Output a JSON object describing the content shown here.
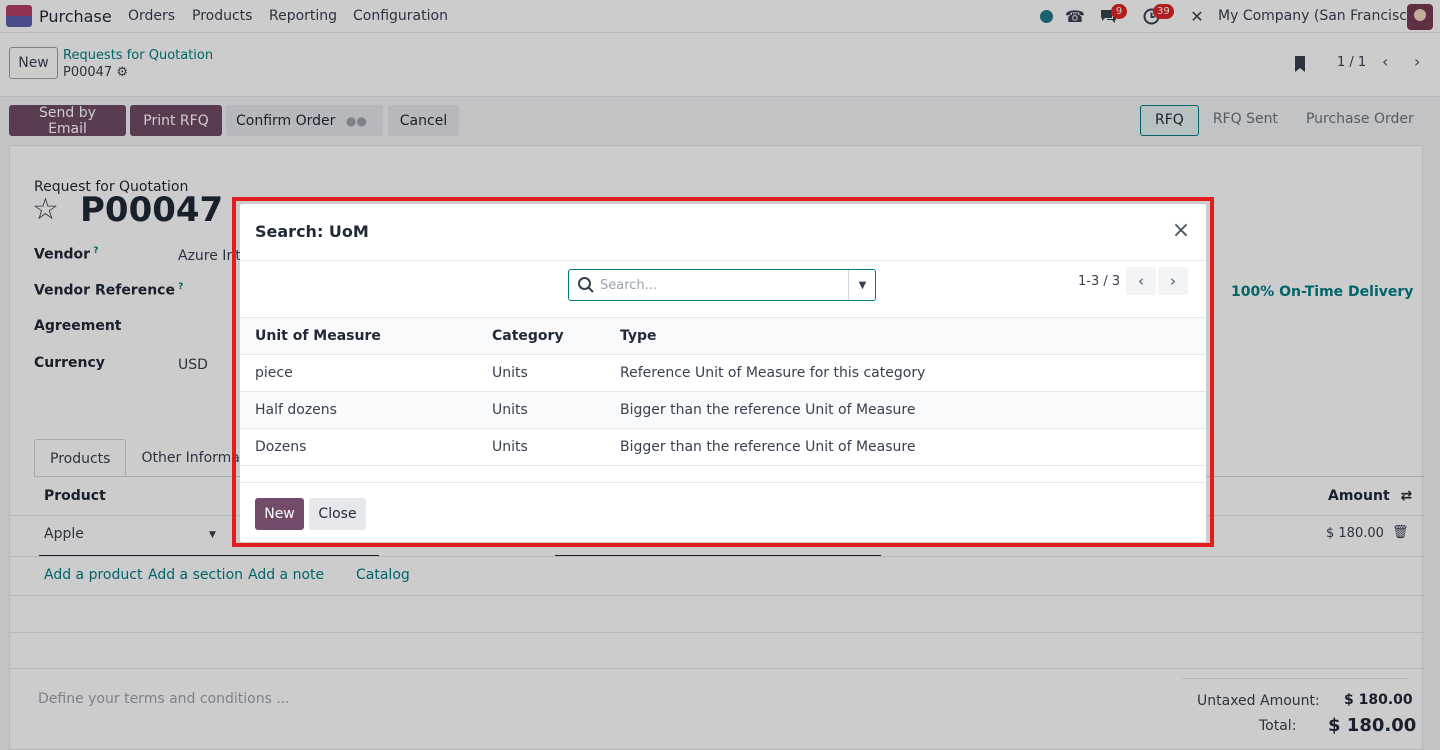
{
  "navbar": {
    "app_name": "Purchase",
    "menus": [
      "Orders",
      "Products",
      "Reporting",
      "Configuration"
    ],
    "messages_count": "9",
    "activities_count": "39",
    "company": "My Company (San Francisco)"
  },
  "control": {
    "new_label": "New",
    "breadcrumb_parent": "Requests for Quotation",
    "record": "P00047",
    "pager": "1 / 1"
  },
  "actions": {
    "send_email": "Send by Email",
    "print_rfq": "Print RFQ",
    "confirm_order": "Confirm Order",
    "cancel": "Cancel",
    "statuses": [
      "RFQ",
      "RFQ Sent",
      "Purchase Order"
    ]
  },
  "form": {
    "title": "Request for Quotation",
    "record_name": "P00047",
    "vendor_label": "Vendor",
    "vendor_value": "Azure Inte",
    "vendor_ref_label": "Vendor Reference",
    "agreement_label": "Agreement",
    "currency_label": "Currency",
    "currency_value": "USD",
    "on_time": "100% On-Time Delivery",
    "tabs": [
      "Products",
      "Other Informatio"
    ],
    "col_product": "Product",
    "col_amount": "Amount",
    "line_product": "Apple",
    "line_amount": "$ 180.00",
    "add_product": "Add a product",
    "add_section": "Add a section",
    "add_note": "Add a note",
    "catalog": "Catalog",
    "terms_placeholder": "Define your terms and conditions ...",
    "untaxed_label": "Untaxed Amount:",
    "untaxed_value": "$ 180.00",
    "total_label": "Total:",
    "total_value": "$ 180.00"
  },
  "dialog": {
    "title": "Search: UoM",
    "search_placeholder": "Search...",
    "pager": "1-3 / 3",
    "columns": [
      "Unit of Measure",
      "Category",
      "Type"
    ],
    "rows": [
      {
        "uom": "piece",
        "category": "Units",
        "type": "Reference Unit of Measure for this category"
      },
      {
        "uom": "Half dozens",
        "category": "Units",
        "type": "Bigger than the reference Unit of Measure"
      },
      {
        "uom": "Dozens",
        "category": "Units",
        "type": "Bigger than the reference Unit of Measure"
      }
    ],
    "new_label": "New",
    "close_label": "Close"
  },
  "colors": {
    "primary": "#714b67",
    "accent": "#017e84",
    "highlight": "#e11d1d"
  }
}
